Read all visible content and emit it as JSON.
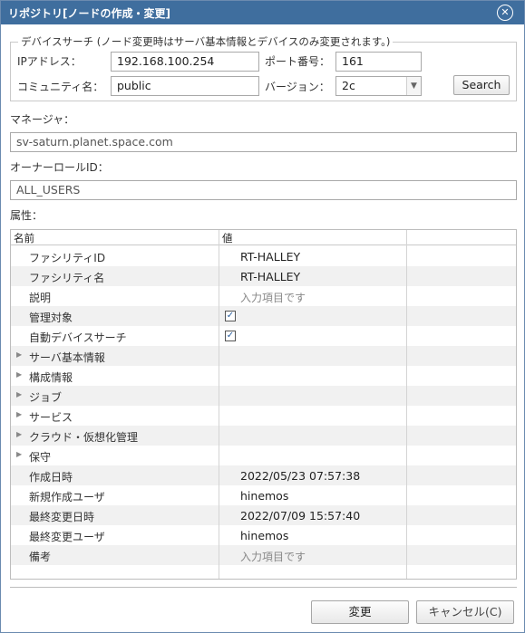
{
  "dialog": {
    "title": "リポジトリ[ノードの作成・変更]",
    "close_symbol": "✕"
  },
  "device_search": {
    "legend": "デバイスサーチ (ノード変更時はサーバ基本情報とデバイスのみ変更されます。)",
    "ip_label": "IPアドレス：",
    "ip_value": "192.168.100.254",
    "port_label": "ポート番号：",
    "port_value": "161",
    "community_label": "コミュニティ名：",
    "community_value": "public",
    "version_label": "バージョン：",
    "version_value": "2c",
    "search_label": "Search"
  },
  "manager": {
    "label": "マネージャ：",
    "value": "sv-saturn.planet.space.com"
  },
  "owner_role": {
    "label": "オーナーロールID：",
    "value": "ALL_USERS"
  },
  "attributes": {
    "label": "属性：",
    "col_name": "名前",
    "col_value": "値",
    "rows": [
      {
        "name": "ファシリティID",
        "value": "RT-HALLEY",
        "type": "text"
      },
      {
        "name": "ファシリティ名",
        "value": "RT-HALLEY",
        "type": "text"
      },
      {
        "name": "説明",
        "value": "入力項目です",
        "type": "placeholder"
      },
      {
        "name": "管理対象",
        "value": "",
        "type": "checkbox",
        "checked": true
      },
      {
        "name": "自動デバイスサーチ",
        "value": "",
        "type": "checkbox",
        "checked": true
      },
      {
        "name": "サーバ基本情報",
        "value": "",
        "type": "group"
      },
      {
        "name": "構成情報",
        "value": "",
        "type": "group"
      },
      {
        "name": "ジョブ",
        "value": "",
        "type": "group"
      },
      {
        "name": "サービス",
        "value": "",
        "type": "group"
      },
      {
        "name": "クラウド・仮想化管理",
        "value": "",
        "type": "group"
      },
      {
        "name": "保守",
        "value": "",
        "type": "group"
      },
      {
        "name": "作成日時",
        "value": "2022/05/23 07:57:38",
        "type": "text"
      },
      {
        "name": "新規作成ユーザ",
        "value": "hinemos",
        "type": "text"
      },
      {
        "name": "最終変更日時",
        "value": "2022/07/09 15:57:40",
        "type": "text"
      },
      {
        "name": "最終変更ユーザ",
        "value": "hinemos",
        "type": "text"
      },
      {
        "name": "備考",
        "value": "入力項目です",
        "type": "placeholder"
      }
    ]
  },
  "footer": {
    "ok_label": "変更",
    "cancel_label": "キャンセル(C)"
  }
}
